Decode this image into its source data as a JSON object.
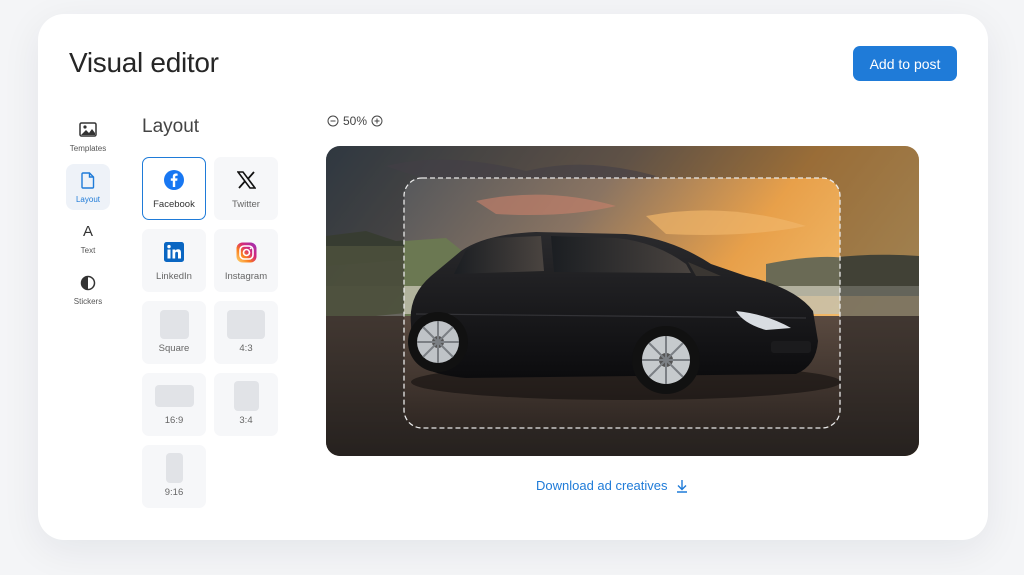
{
  "header": {
    "title": "Visual editor",
    "add_button_label": "Add to post"
  },
  "rail": {
    "items": [
      {
        "label": "Templates",
        "icon": "image-icon"
      },
      {
        "label": "Layout",
        "icon": "document-icon",
        "active": true
      },
      {
        "label": "Text",
        "icon": "text-icon"
      },
      {
        "label": "Stickers",
        "icon": "contrast-icon"
      }
    ],
    "text_glyph": "A"
  },
  "layout_panel": {
    "title": "Layout",
    "tiles": [
      {
        "label": "Facebook",
        "icon": "facebook-icon",
        "selected": true
      },
      {
        "label": "Twitter",
        "icon": "x-icon"
      },
      {
        "label": "LinkedIn",
        "icon": "linkedin-icon"
      },
      {
        "label": "Instagram",
        "icon": "instagram-icon"
      },
      {
        "label": "Square"
      },
      {
        "label": "4:3"
      },
      {
        "label": "16:9"
      },
      {
        "label": "3:4"
      },
      {
        "label": "9:16"
      }
    ]
  },
  "zoom": {
    "value": "50%"
  },
  "download": {
    "label": "Download ad creatives",
    "icon": "download-arrow-icon"
  },
  "colors": {
    "accent": "#1f7bd8",
    "facebook": "#1877f2",
    "linkedin": "#0a66c2"
  }
}
